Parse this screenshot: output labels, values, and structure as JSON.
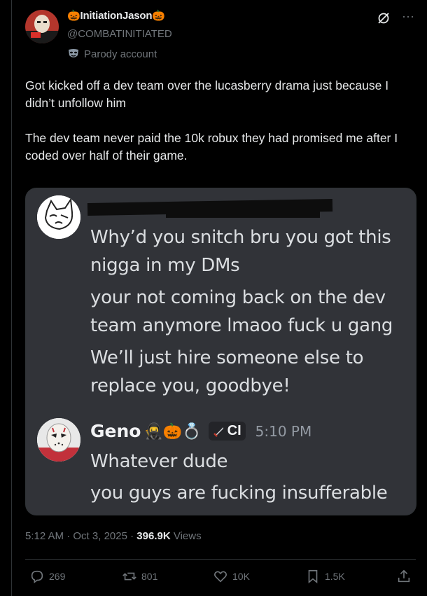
{
  "author": {
    "display_name": "InitiationJason",
    "name_prefix_emoji": "🎃",
    "name_suffix_emoji": "🎃",
    "handle": "@COMBATINITIATED",
    "parody_label": "Parody account"
  },
  "tweet": {
    "paragraphs": [
      "Got kicked off a dev team over the lucasberry drama just because I didn’t unfollow him",
      "The dev team never paid the 10k robux they had promised me after I coded over half of their game."
    ]
  },
  "screenshot": {
    "messages_top": [
      "Why’d you snitch bru you got this\nnigga in my DMs",
      "your not coming back on the dev\nteam anymore lmaoo fuck u gang",
      "We’ll just hire someone else to\nreplace you, goodbye!"
    ],
    "reply_author": "Geno",
    "reply_emojis": "🥷🎃💍",
    "role_label": "CI",
    "reply_time": "5:10 PM",
    "messages_bottom": [
      "Whatever dude",
      "you guys are fucking insufferable"
    ]
  },
  "meta": {
    "time": "5:12 AM",
    "date": "Oct 3, 2025",
    "views_count": "396.9K",
    "views_label": "Views"
  },
  "actions": {
    "replies": "269",
    "reposts": "801",
    "likes": "10K",
    "bookmarks": "1.5K"
  },
  "colors": {
    "background": "#000000",
    "text": "#e7e9ea",
    "muted": "#71767b",
    "discord_bg": "#313338"
  }
}
